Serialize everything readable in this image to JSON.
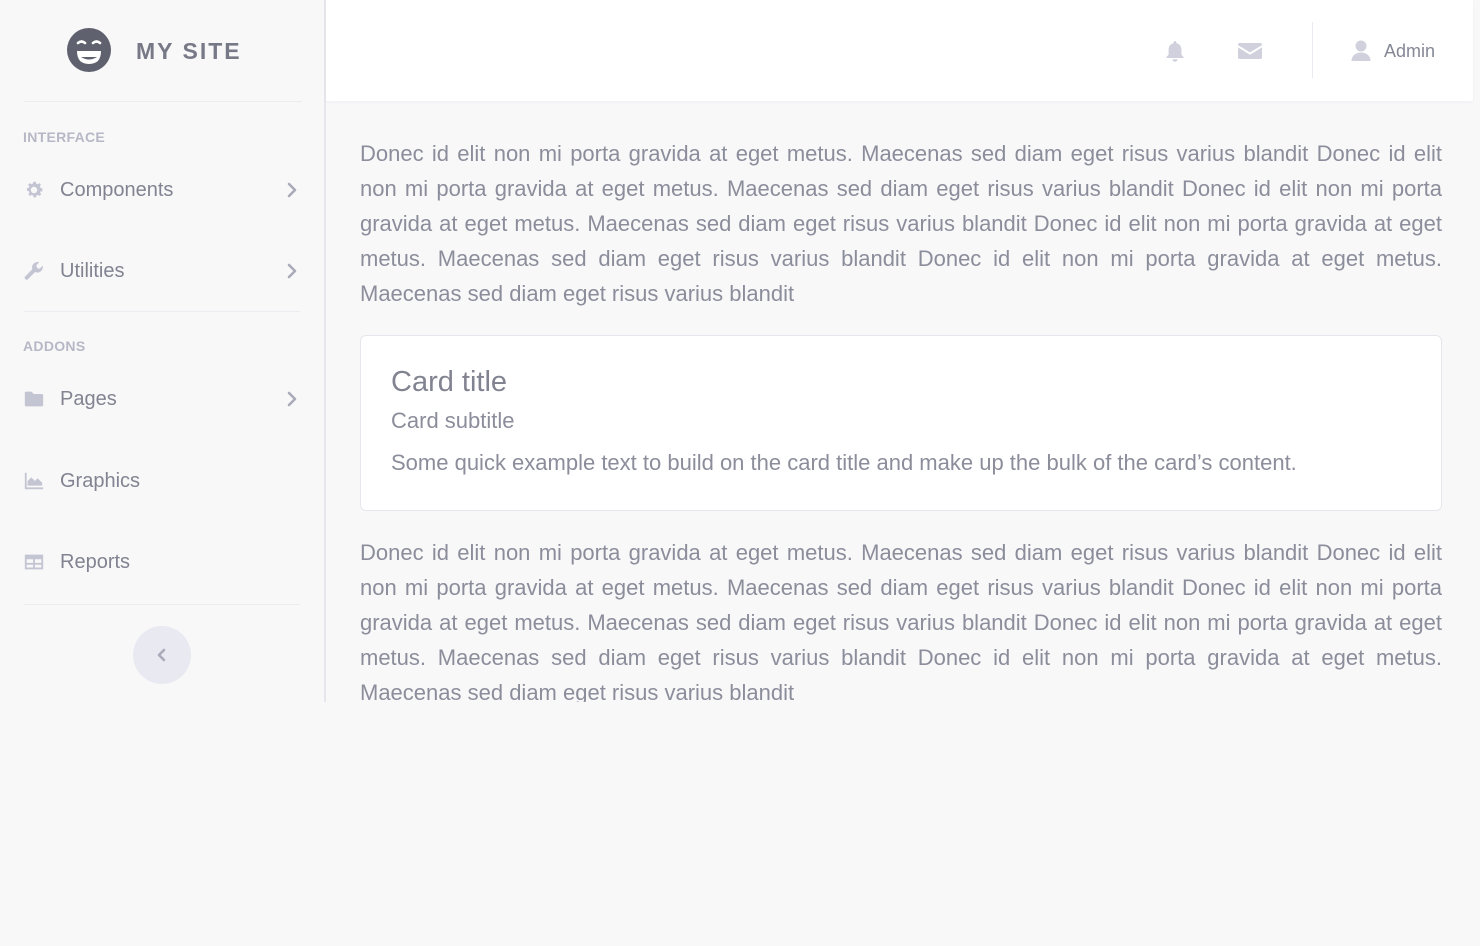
{
  "brand": {
    "name": "MY SITE",
    "logo_icon": "smiley-wink-icon"
  },
  "sidebar": {
    "sections": [
      {
        "heading": "INTERFACE"
      },
      {
        "heading": "ADDONS"
      }
    ],
    "items": [
      {
        "label": "Components",
        "icon": "gear-icon",
        "has_submenu": true
      },
      {
        "label": "Utilities",
        "icon": "wrench-icon",
        "has_submenu": true
      },
      {
        "label": "Pages",
        "icon": "folder-icon",
        "has_submenu": true
      },
      {
        "label": "Graphics",
        "icon": "area-chart-icon",
        "has_submenu": false
      },
      {
        "label": "Reports",
        "icon": "table-icon",
        "has_submenu": false
      }
    ],
    "collapse_icon": "chevron-left-icon"
  },
  "topbar": {
    "alerts_icon": "bell-icon",
    "messages_icon": "envelope-icon",
    "user": {
      "name": "Admin",
      "icon": "user-icon"
    }
  },
  "content": {
    "paragraph_1": "Donec id elit non mi porta gravida at eget metus. Maecenas sed diam eget risus varius blandit Donec id elit non mi porta gravida at eget metus. Maecenas sed diam eget risus varius blandit Donec id elit non mi porta gravida at eget metus. Maecenas sed diam eget risus varius blandit Donec id elit non mi porta gravida at eget metus. Maecenas sed diam eget risus varius blandit Donec id elit non mi porta gravida at eget metus. Maecenas sed diam eget risus varius blandit",
    "card": {
      "title": "Card title",
      "subtitle": "Card subtitle",
      "text": "Some quick example text to build on the card title and make up the bulk of the card’s content."
    },
    "paragraph_2": "Donec id elit non mi porta gravida at eget metus. Maecenas sed diam eget risus varius blandit Donec id elit non mi porta gravida at eget metus. Maecenas sed diam eget risus varius blandit Donec id elit non mi porta gravida at eget metus. Maecenas sed diam eget risus varius blandit Donec id elit non mi porta gravida at eget metus. Maecenas sed diam eget risus varius blandit Donec id elit non mi porta gravida at eget metus. Maecenas sed diam eget risus varius blandit"
  },
  "colors": {
    "icon": "#c4c5d3",
    "text": "#858796",
    "background": "#f8f8f9",
    "card": "#ffffff"
  }
}
